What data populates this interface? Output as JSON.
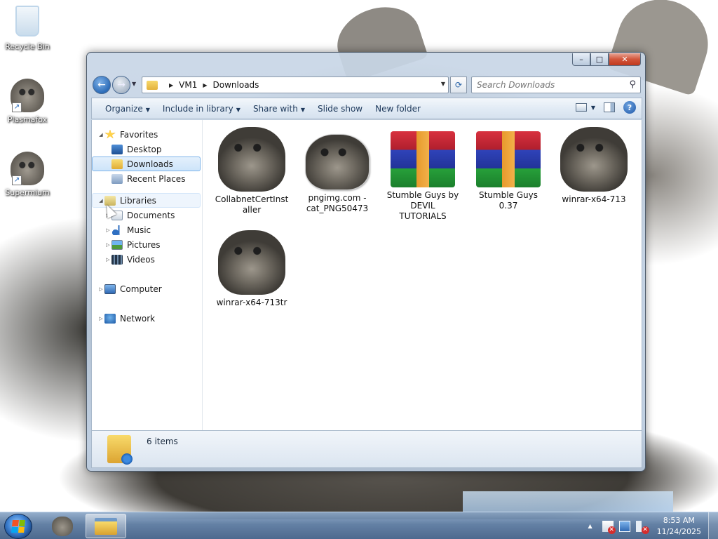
{
  "desktop": {
    "icons": [
      {
        "label": "Recycle Bin",
        "icon": "recycle-bin-icon"
      },
      {
        "label": "Plasmafox",
        "icon": "cat-shortcut-icon"
      },
      {
        "label": "Supermium",
        "icon": "cat-shortcut-icon"
      }
    ]
  },
  "window": {
    "caption": {
      "minimize": "–",
      "maximize": "□",
      "close": "✕"
    },
    "address": {
      "segments": [
        "VM1",
        "Downloads"
      ]
    },
    "search": {
      "placeholder": "Search Downloads"
    },
    "toolbar": {
      "organize": "Organize",
      "include_in_library": "Include in library",
      "share_with": "Share with",
      "slide_show": "Slide show",
      "new_folder": "New folder",
      "help": "?"
    },
    "navigation": {
      "favorites": "Favorites",
      "desktop": "Desktop",
      "downloads": "Downloads",
      "recent_places": "Recent Places",
      "libraries": "Libraries",
      "documents": "Documents",
      "music": "Music",
      "pictures": "Pictures",
      "videos": "Videos",
      "computer": "Computer",
      "network": "Network"
    },
    "files": [
      {
        "name": "CollabnetCertInstaller",
        "type": "cat-image"
      },
      {
        "name": "pngimg.com - cat_PNG50473",
        "type": "cat-image-framed"
      },
      {
        "name": "Stumble Guys  by DEVIL TUTORIALS",
        "type": "winrar-archive"
      },
      {
        "name": "Stumble Guys 0.37",
        "type": "winrar-archive"
      },
      {
        "name": "winrar-x64-713",
        "type": "cat-image"
      },
      {
        "name": "winrar-x64-713tr",
        "type": "cat-image"
      }
    ],
    "details": {
      "item_count": "6 items"
    }
  },
  "taskbar": {
    "clock_time": "8:53 AM",
    "clock_date": "11/24/2025"
  }
}
